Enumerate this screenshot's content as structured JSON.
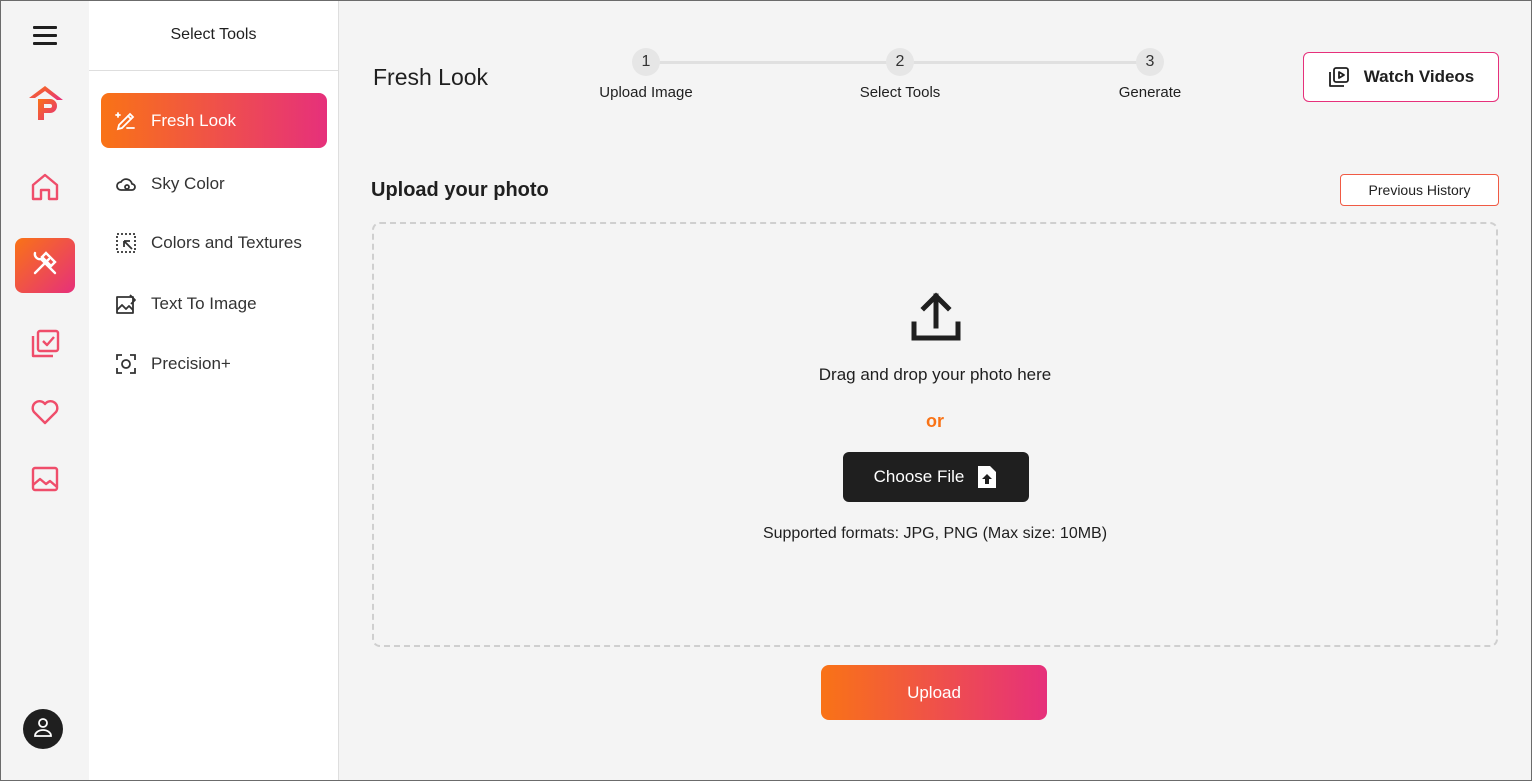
{
  "sidebar_title": "Select Tools",
  "tools": [
    {
      "label": "Fresh Look",
      "icon": "pen-sparkle-icon",
      "active": true
    },
    {
      "label": "Sky Color",
      "icon": "cloud-icon",
      "active": false
    },
    {
      "label": "Colors and Textures",
      "icon": "selection-cursor-icon",
      "active": false
    },
    {
      "label": "Text To Image",
      "icon": "image-edit-icon",
      "active": false
    },
    {
      "label": "Precision+",
      "icon": "focus-icon",
      "active": false
    }
  ],
  "rail": {
    "items": [
      "home-icon",
      "tools-icon",
      "checklist-icon",
      "heart-icon",
      "gallery-icon"
    ],
    "active": "tools-icon"
  },
  "header": {
    "title": "Fresh Look",
    "watch_videos": "Watch Videos"
  },
  "steps": [
    {
      "num": "1",
      "label": "Upload Image"
    },
    {
      "num": "2",
      "label": "Select Tools"
    },
    {
      "num": "3",
      "label": "Generate"
    }
  ],
  "upload": {
    "section_title": "Upload your photo",
    "previous_history": "Previous History",
    "drag_text": "Drag and drop your photo here",
    "or_text": "or",
    "choose_file": "Choose File",
    "formats": "Supported formats: JPG, PNG (Max size: 10MB)",
    "upload_button": "Upload"
  },
  "colors": {
    "accent_start": "#f97316",
    "accent_end": "#e6307b",
    "dark": "#1f1f1f"
  }
}
